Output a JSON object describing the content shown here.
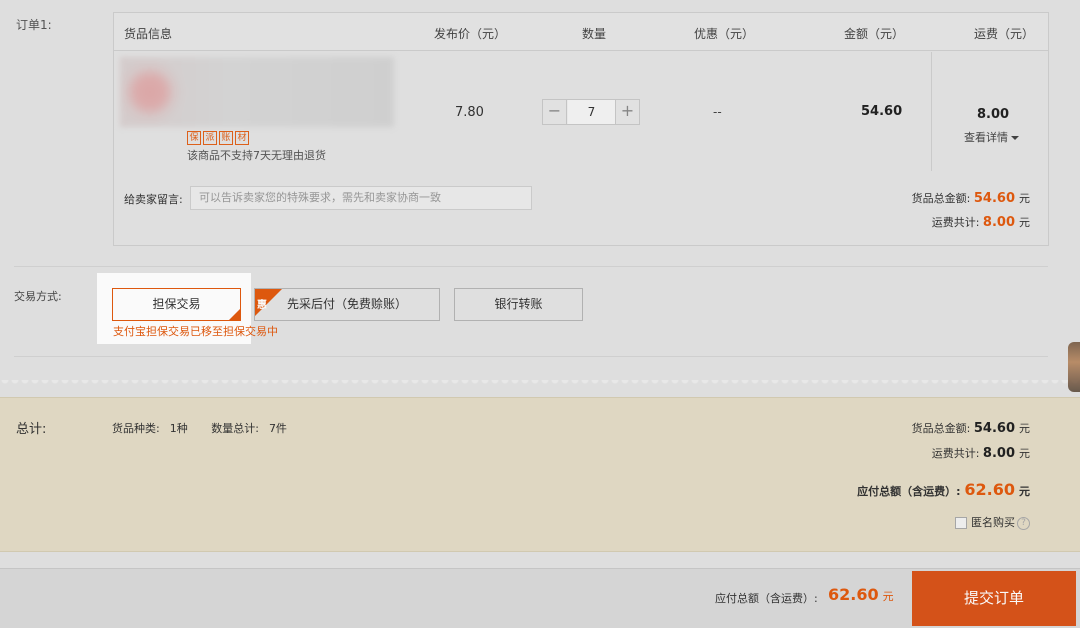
{
  "order": {
    "label": "订单1:",
    "headers": {
      "goods": "货品信息",
      "price": "发布价（元）",
      "qty": "数量",
      "discount": "优惠（元）",
      "amount": "金额（元）",
      "shipping": "运费（元）"
    },
    "item": {
      "service_tags": [
        "保",
        "派",
        "账",
        "材"
      ],
      "no_return_text": "该商品不支持7天无理由退货",
      "price": "7.80",
      "quantity": "7",
      "qty_minus": "−",
      "qty_plus": "+",
      "discount": "--",
      "amount": "54.60",
      "shipping_value": "8.00",
      "shipping_detail": "查看详情"
    },
    "message": {
      "label": "给卖家留言:",
      "placeholder": "可以告诉卖家您的特殊要求，需先和卖家协商一致"
    },
    "subtotal": {
      "goods_label": "货品总金额:",
      "goods_value": "54.60",
      "shipping_label": "运费共计:",
      "shipping_value": "8.00",
      "unit": "元"
    }
  },
  "trade": {
    "label": "交易方式:",
    "options": [
      {
        "label": "担保交易",
        "selected": true
      },
      {
        "label": "先采后付（免费赊账）",
        "badge": "惠"
      },
      {
        "label": "银行转账"
      }
    ],
    "note": "支付宝担保交易已移至担保交易中"
  },
  "summary": {
    "label": "总计:",
    "kinds_label": "货品种类:",
    "kinds_value": "1种",
    "count_label": "数量总计:",
    "count_value": "7件",
    "goods_label": "货品总金额:",
    "goods_value": "54.60",
    "shipping_label": "运费共计:",
    "shipping_value": "8.00",
    "payable_label": "应付总额（含运费）:",
    "payable_value": "62.60",
    "unit": "元",
    "anonymous_label": "匿名购买",
    "help": "?"
  },
  "bottom": {
    "payable_label": "应付总额（含运费）:",
    "payable_value": "62.60",
    "unit": "元",
    "submit_label": "提交订单"
  },
  "colors": {
    "accent": "#e25a0f",
    "submit": "#d9541a",
    "summary_bg": "#e4dcc6"
  }
}
